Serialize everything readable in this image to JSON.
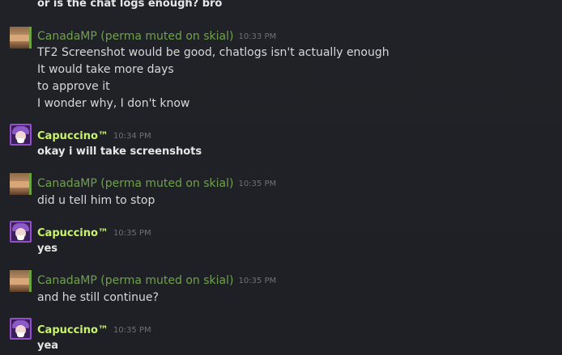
{
  "messages": {
    "m0": {
      "text": "or is the chat logs enough? bro"
    },
    "g1": {
      "sender": "CanadaMP (perma muted on skial)",
      "time": "10:33 PM",
      "lines": [
        "TF2 Screenshot would be good, chatlogs isn't actually enough",
        "It would take more days",
        "to approve it",
        "I wonder why, I don't know"
      ]
    },
    "g2": {
      "sender": "Capuccino™",
      "time": "10:34 PM",
      "lines": [
        "okay i will take screenshots"
      ]
    },
    "g3": {
      "sender": "CanadaMP (perma muted on skial)",
      "time": "10:35 PM",
      "lines": [
        "did u tell him to stop"
      ]
    },
    "g4": {
      "sender": "Capuccino™",
      "time": "10:35 PM",
      "lines": [
        "yes"
      ]
    },
    "g5": {
      "sender": "CanadaMP (perma muted on skial)",
      "time": "10:35 PM",
      "lines": [
        "and he still continue?"
      ]
    },
    "g6": {
      "sender": "Capuccino™",
      "time": "10:35 PM",
      "lines": [
        "yea"
      ]
    }
  },
  "colors": {
    "background": "#1f2126",
    "canada_name": "#6fa14b",
    "capuccino_name": "#c9f46a",
    "timestamp": "#6c717a",
    "message_text": "#d9dadc"
  },
  "icons": {
    "canada_avatar": "canada-avatar-icon",
    "capuccino_avatar": "capuccino-avatar-icon"
  }
}
